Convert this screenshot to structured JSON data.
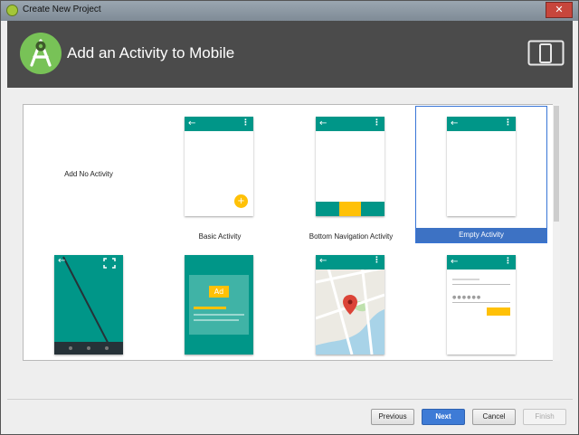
{
  "window": {
    "title": "Create New Project",
    "close_glyph": "✕"
  },
  "header": {
    "title": "Add an Activity to Mobile",
    "logo_icon": "android-studio-logo-icon",
    "device_icon": "phone-tablet-icon"
  },
  "gallery": {
    "selected": "Empty Activity",
    "items": [
      {
        "label": "Add No Activity",
        "preview": "none"
      },
      {
        "label": "Basic Activity",
        "preview": "basic"
      },
      {
        "label": "Bottom Navigation Activity",
        "preview": "bottom-nav"
      },
      {
        "label": "Empty Activity",
        "preview": "empty"
      },
      {
        "label": "",
        "preview": "fullscreen"
      },
      {
        "label": "",
        "preview": "admob",
        "ad_text": "Ad"
      },
      {
        "label": "",
        "preview": "maps"
      },
      {
        "label": "",
        "preview": "login"
      }
    ]
  },
  "colors": {
    "accent": "#009688",
    "fab": "#ffc107",
    "selection": "#3d72c4",
    "header": "#4b4b4b"
  },
  "buttons": {
    "previous": "Previous",
    "next": "Next",
    "cancel": "Cancel",
    "finish": "Finish"
  }
}
